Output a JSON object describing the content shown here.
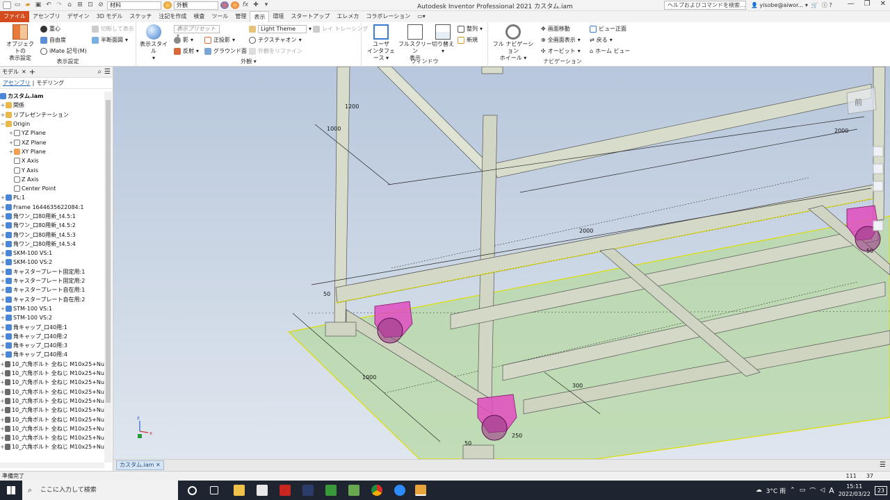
{
  "app": {
    "title": "Autodesk Inventor Professional 2021   カスタム.iam",
    "help_placeholder": "ヘルプおよびコマンドを検索...",
    "user": "yisobe@aiwor...",
    "material_select": "材料",
    "appearance_select": "外観"
  },
  "tabs": [
    "ファイル",
    "アセンブリ",
    "デザイン",
    "3D モデル",
    "スケッチ",
    "注記を作成",
    "検査",
    "ツール",
    "管理",
    "表示",
    "環境",
    "スタートアップ",
    "エレメカ",
    "コラボレーション"
  ],
  "active_tab": "表示",
  "ribbon": {
    "display_settings": {
      "title": "表示設定",
      "object_display": "オブジェクトの\n表示設定",
      "center_of_gravity": "重心",
      "dof": "自由度",
      "imate": "iMate 記号(M)",
      "cut_display": "切断して表示",
      "half_section": "半断面図"
    },
    "appearance": {
      "title": "外観",
      "visual_style": "表示スタイル",
      "display_preset": "表示プリセット",
      "theme": "Light Theme",
      "ray_tracing": "レイ トレーシング",
      "shadow": "影",
      "reflection": "反射",
      "ortho": "正投影",
      "ground": "グラウンド面",
      "texture_on": "テクスチャオン",
      "refine_appearance": "外観をリファイン"
    },
    "window": {
      "title": "ウィンドウ",
      "user_interface": "ユーザ\nインタフェース",
      "full_screen": "フルスクリーン\n表示",
      "switch": "切り替え",
      "arrange": "整列",
      "new": "新規"
    },
    "navigation": {
      "title": "ナビゲーション",
      "full_nav_wheel": "フル ナビゲーション\nホイール",
      "pan": "画面移動",
      "zoom_all": "全画面表示",
      "orbit": "オービット",
      "view_face": "ビュー正面",
      "back": "戻る",
      "home_view": "ホーム ビュー"
    }
  },
  "browser": {
    "tab": "モデル",
    "mode_assembly": "アセンブリ",
    "mode_modeling": "モデリング",
    "root": "カスタム.iam",
    "items": [
      {
        "label": "関係",
        "kind": "folder",
        "exp": "+"
      },
      {
        "label": "リプレゼンテーション",
        "kind": "folder",
        "exp": "+"
      },
      {
        "label": "Origin",
        "kind": "folder",
        "exp": "−"
      },
      {
        "label": "YZ Plane",
        "kind": "plane",
        "exp": "+",
        "indent": 1
      },
      {
        "label": "XZ Plane",
        "kind": "plane",
        "exp": "+",
        "indent": 1
      },
      {
        "label": "XY Plane",
        "kind": "plane-orange",
        "exp": "+",
        "indent": 1
      },
      {
        "label": "X Axis",
        "kind": "axis",
        "exp": "",
        "indent": 1
      },
      {
        "label": "Y Axis",
        "kind": "axis",
        "exp": "",
        "indent": 1
      },
      {
        "label": "Z Axis",
        "kind": "axis",
        "exp": "",
        "indent": 1
      },
      {
        "label": "Center Point",
        "kind": "point",
        "exp": "",
        "indent": 1
      },
      {
        "label": "PL:1",
        "kind": "part",
        "exp": "+"
      },
      {
        "label": "Frame 1644635622084:1",
        "kind": "asm",
        "exp": "+"
      },
      {
        "label": "角ワン_口80用新_t4.5:1",
        "kind": "part",
        "exp": "+"
      },
      {
        "label": "角ワン_口80用新_t4.5:2",
        "kind": "part",
        "exp": "+"
      },
      {
        "label": "角ワン_口80用新_t4.5:3",
        "kind": "part",
        "exp": "+"
      },
      {
        "label": "角ワン_口80用新_t4.5:4",
        "kind": "part",
        "exp": "+"
      },
      {
        "label": "SKM-100 VS:1",
        "kind": "asm",
        "exp": "+"
      },
      {
        "label": "SKM-100 VS:2",
        "kind": "asm",
        "exp": "+"
      },
      {
        "label": "キャスタープレート固定用:1",
        "kind": "part",
        "exp": "+"
      },
      {
        "label": "キャスタープレート固定用:2",
        "kind": "part",
        "exp": "+"
      },
      {
        "label": "キャスタープレート自在用:1",
        "kind": "part",
        "exp": "+"
      },
      {
        "label": "キャスタープレート自在用:2",
        "kind": "part",
        "exp": "+"
      },
      {
        "label": "STM-100 VS:1",
        "kind": "asm",
        "exp": "+"
      },
      {
        "label": "STM-100 VS:2",
        "kind": "asm",
        "exp": "+"
      },
      {
        "label": "角キャップ_口40用:1",
        "kind": "part",
        "exp": "+"
      },
      {
        "label": "角キャップ_口40用:2",
        "kind": "part",
        "exp": "+"
      },
      {
        "label": "角キャップ_口40用:3",
        "kind": "part",
        "exp": "+"
      },
      {
        "label": "角キャップ_口40用:4",
        "kind": "part",
        "exp": "+"
      },
      {
        "label": "10_六角ボルト 全ねじ M10x25+Nu",
        "kind": "bolt",
        "exp": "+"
      },
      {
        "label": "10_六角ボルト 全ねじ M10x25+Nu",
        "kind": "bolt",
        "exp": "+"
      },
      {
        "label": "10_六角ボルト 全ねじ M10x25+Nu",
        "kind": "bolt",
        "exp": "+"
      },
      {
        "label": "10_六角ボルト 全ねじ M10x25+Nu",
        "kind": "bolt",
        "exp": "+"
      },
      {
        "label": "10_六角ボルト 全ねじ M10x25+Nu",
        "kind": "bolt",
        "exp": "+"
      },
      {
        "label": "10_六角ボルト 全ねじ M10x25+Nu",
        "kind": "bolt",
        "exp": "+"
      },
      {
        "label": "10_六角ボルト 全ねじ M10x25+Nu",
        "kind": "bolt",
        "exp": "+"
      },
      {
        "label": "10_六角ボルト 全ねじ M10x25+Nu",
        "kind": "bolt",
        "exp": "+"
      },
      {
        "label": "10_六角ボルト 全ねじ M10x25+Nu",
        "kind": "bolt",
        "exp": "+"
      },
      {
        "label": "10_六角ボルト 全ねじ M10x25+Nu",
        "kind": "bolt",
        "exp": "+"
      }
    ]
  },
  "dimensions": [
    "1200",
    "1000",
    "2000",
    "2000",
    "50",
    "1000",
    "300",
    "250",
    "50",
    "50"
  ],
  "viewcube_label": "前",
  "document_tab": "カスタム.iam",
  "status": {
    "text": "準備完了",
    "num1": "111",
    "num2": "37"
  },
  "taskbar": {
    "search": "ここに入力して検索",
    "weather": "3°C 雨",
    "ime": "A",
    "time": "15:11",
    "date": "2022/03/22",
    "notifications": "23"
  },
  "colors": {
    "file_tab": "#d64b1e",
    "caster": "#e14cc0",
    "floor": "#b9d9a8",
    "frame": "#d8dccb"
  }
}
